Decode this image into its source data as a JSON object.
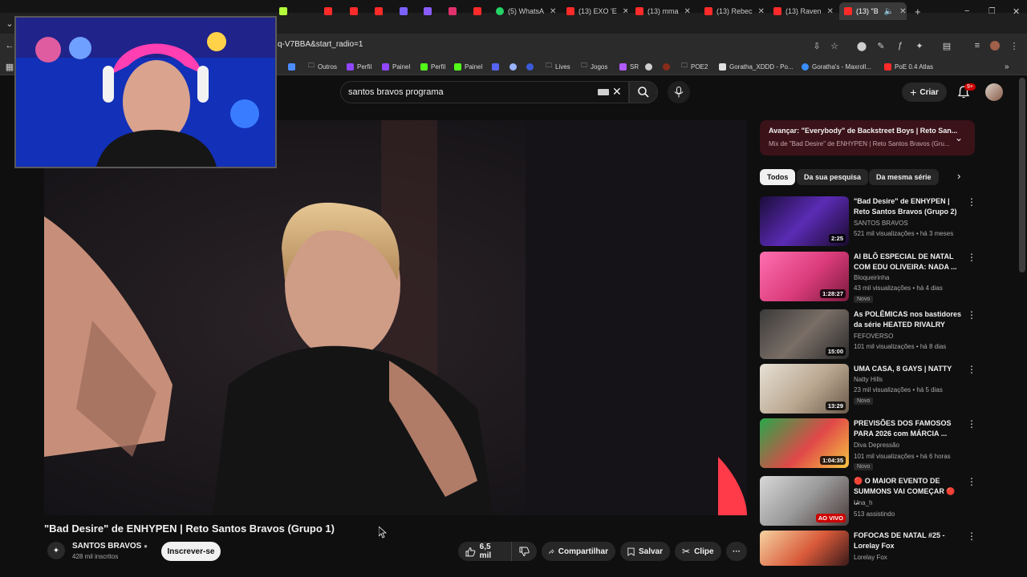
{
  "browser": {
    "tabs": [
      {
        "label": "",
        "color": "#ff3d3d"
      },
      {
        "label": "",
        "color": "#ff2a2a"
      },
      {
        "label": "",
        "color": "#ff2a2a"
      },
      {
        "label": "",
        "color": "#7b61ff"
      },
      {
        "label": "",
        "color": "#8a5cff"
      },
      {
        "label": "",
        "color": "#e1306c"
      },
      {
        "label": "",
        "color": "#ff2a2a"
      },
      {
        "label": "(5) WhatsA",
        "color": "#25d366"
      },
      {
        "label": "(13) EXO 'E",
        "color": "#ff2a2a"
      },
      {
        "label": "(13) mma",
        "color": "#ff2a2a"
      },
      {
        "label": "(13) Rebec",
        "color": "#ff2a2a"
      },
      {
        "label": "(13) Raven",
        "color": "#ff2a2a"
      },
      {
        "label": "(13) \"B",
        "color": "#ff2a2a"
      }
    ],
    "url": "q-V7BBA&start_radio=1",
    "bookmarks": [
      "Outros",
      "Perfil",
      "Painel",
      "Perfil",
      "Painel",
      "Lives",
      "Jogos",
      "SR",
      "POE2",
      "Goratha_XDDD - Po...",
      "Goratha's - Maxroll...",
      "PoE 0.4 Atlas"
    ]
  },
  "youtube": {
    "search_value": "santos bravos programa",
    "create_label": "Criar",
    "notif_count": "9+"
  },
  "video": {
    "title": "\"Bad Desire\" de ENHYPEN | Reto Santos Bravos (Grupo 1)",
    "channel": "SANTOS BRAVOS",
    "subscribers": "428 mil inscritos",
    "subscribe_label": "Inscrever-se",
    "likes": "6,5 mil",
    "share_label": "Compartilhar",
    "save_label": "Salvar",
    "clip_label": "Clipe"
  },
  "sidebar": {
    "next_label": "Avançar: \"Everybody\" de Backstreet Boys | Reto San...",
    "mix_label": "Mix de \"Bad Desire\" de ENHYPEN | Reto Santos Bravos (Gru...",
    "chips": [
      "Todos",
      "Da sua pesquisa",
      "Da mesma série"
    ],
    "videos": [
      {
        "title": "\"Bad Desire\" de ENHYPEN | Reto Santos Bravos (Grupo 2)",
        "channel": "SANTOS BRAVOS",
        "meta": "521 mil visualizações • há 3 meses",
        "duration": "2:25",
        "new": "",
        "live": ""
      },
      {
        "title": "AI BLÔ ESPECIAL DE NATAL COM EDU OLIVEIRA: NADA ...",
        "channel": "Bloqueirinha",
        "meta": "43 mil visualizações • há 4 dias",
        "duration": "1:28:27",
        "new": "Novo",
        "live": ""
      },
      {
        "title": "As POLÊMICAS nos bastidores da série HEATED RIVALRY",
        "channel": "FEFOVERSO",
        "meta": "101 mil visualizações • há 8 dias",
        "duration": "15:00",
        "new": "",
        "live": ""
      },
      {
        "title": "UMA CASA, 8 GAYS | NATTY",
        "channel": "Natty Hills",
        "meta": "23 mil visualizações • há 5 dias",
        "duration": "13:29",
        "new": "Novo",
        "live": ""
      },
      {
        "title": "PREVISÕES DOS FAMOSOS PARA 2026 com MÁRCIA ...",
        "channel": "Diva Depressão",
        "meta": "101 mil visualizações • há 6 horas",
        "duration": "1:04:35",
        "new": "Novo",
        "live": ""
      },
      {
        "title": "🔴 O MAIOR EVENTO DE SUMMONS VAI COMEÇAR 🔴 ...",
        "channel": "Una_h",
        "meta": "513 assistindo",
        "duration": "",
        "new": "",
        "live": "AO VIVO"
      },
      {
        "title": "FOFOCAS DE NATAL #25 - Lorelay Fox",
        "channel": "Lorelay Fox",
        "meta": "",
        "duration": "",
        "new": "",
        "live": ""
      }
    ]
  }
}
